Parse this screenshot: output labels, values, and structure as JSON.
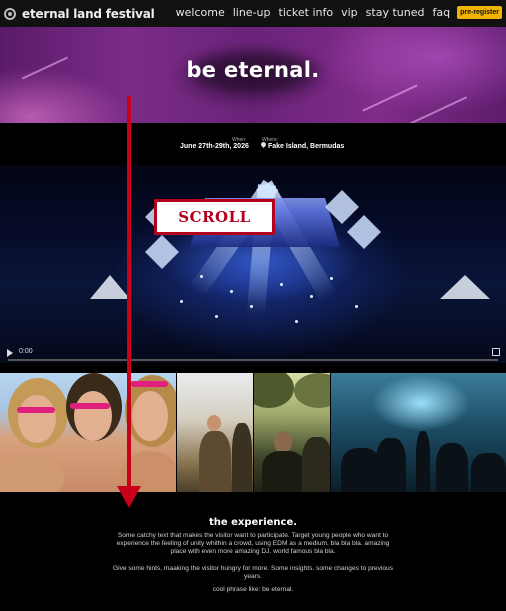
{
  "nav": {
    "brand": "eternal land festival",
    "links": [
      "welcome",
      "line-up",
      "ticket info",
      "vip",
      "stay tuned",
      "faq"
    ],
    "cta": "pre-register"
  },
  "hero": {
    "title": "be eternal."
  },
  "info": {
    "when_label": "When:",
    "when_value": "June 27th-29th, 2026",
    "where_label": "Where:",
    "where_value": "Fake Island, Bermudas"
  },
  "video": {
    "time": "0:00",
    "progress": 0
  },
  "overlay": {
    "scroll_label": "SCROLL"
  },
  "experience": {
    "title": "the experience.",
    "p1": "Some catchy text that makes the visitor want to participate. Target young people who want to experience the feeling of unity whithin a crowd, using EDM as a medium. bla bla bla. amazing place with even more amazing DJ. world famous bla bla.",
    "p2": "Give some hints, maaking the visitor hungry for more. Some insights. some changes to previous years.",
    "p3": "cool phrase like: be eternal."
  },
  "colors": {
    "accent": "#f0b400",
    "annotation": "#c8001a"
  }
}
